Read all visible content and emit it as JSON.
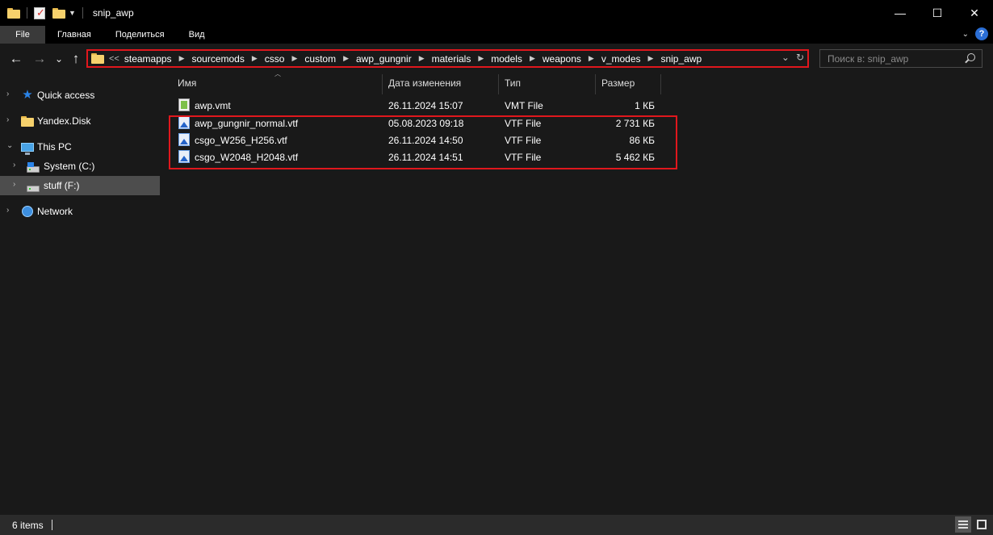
{
  "window": {
    "title": "snip_awp",
    "minimize": "—",
    "maximize": "☐",
    "close": "✕"
  },
  "ribbon": {
    "tabs": [
      "File",
      "Главная",
      "Поделиться",
      "Вид"
    ],
    "expand_icon": "chevron-down-icon",
    "help_icon": "?"
  },
  "nav": {
    "back": "←",
    "forward": "→",
    "recent": "⌄",
    "up": "↑",
    "address_prefix": "<<",
    "breadcrumbs": [
      "steamapps",
      "sourcemods",
      "csso",
      "custom",
      "awp_gungnir",
      "materials",
      "models",
      "weapons",
      "v_modes",
      "snip_awp"
    ],
    "address_dropdown": "⌄",
    "refresh": "↻",
    "search_placeholder": "Поиск в: snip_awp"
  },
  "sidebar": {
    "items": [
      {
        "label": "Quick access",
        "icon": "star-icon"
      },
      {
        "label": "Yandex.Disk",
        "icon": "folder-icon"
      },
      {
        "label": "This PC",
        "icon": "computer-icon"
      },
      {
        "label": "System (C:)",
        "icon": "drive-icon"
      },
      {
        "label": "stuff (F:)",
        "icon": "drive-icon",
        "selected": true
      },
      {
        "label": "Network",
        "icon": "network-icon"
      }
    ]
  },
  "columns": {
    "name": "Имя",
    "date": "Дата изменения",
    "type": "Тип",
    "size": "Размер"
  },
  "files": [
    {
      "name": "awp.vmt",
      "date": "26.11.2024 15:07",
      "type": "VMT File",
      "size": "1 КБ",
      "icon": "vmt-file-icon"
    },
    {
      "name": "awp_gungnir_normal.vtf",
      "date": "05.08.2023 09:18",
      "type": "VTF File",
      "size": "2 731 КБ",
      "icon": "vtf-file-icon"
    },
    {
      "name": "csgo_W256_H256.vtf",
      "date": "26.11.2024 14:50",
      "type": "VTF File",
      "size": "86 КБ",
      "icon": "vtf-file-icon"
    },
    {
      "name": "csgo_W2048_H2048.vtf",
      "date": "26.11.2024 14:51",
      "type": "VTF File",
      "size": "5 462 КБ",
      "icon": "vtf-file-icon"
    }
  ],
  "status": {
    "items_count": "6 items"
  },
  "colors": {
    "highlight_box": "#e0171d",
    "background": "#191919",
    "selected_nav": "#4d4d4d"
  }
}
